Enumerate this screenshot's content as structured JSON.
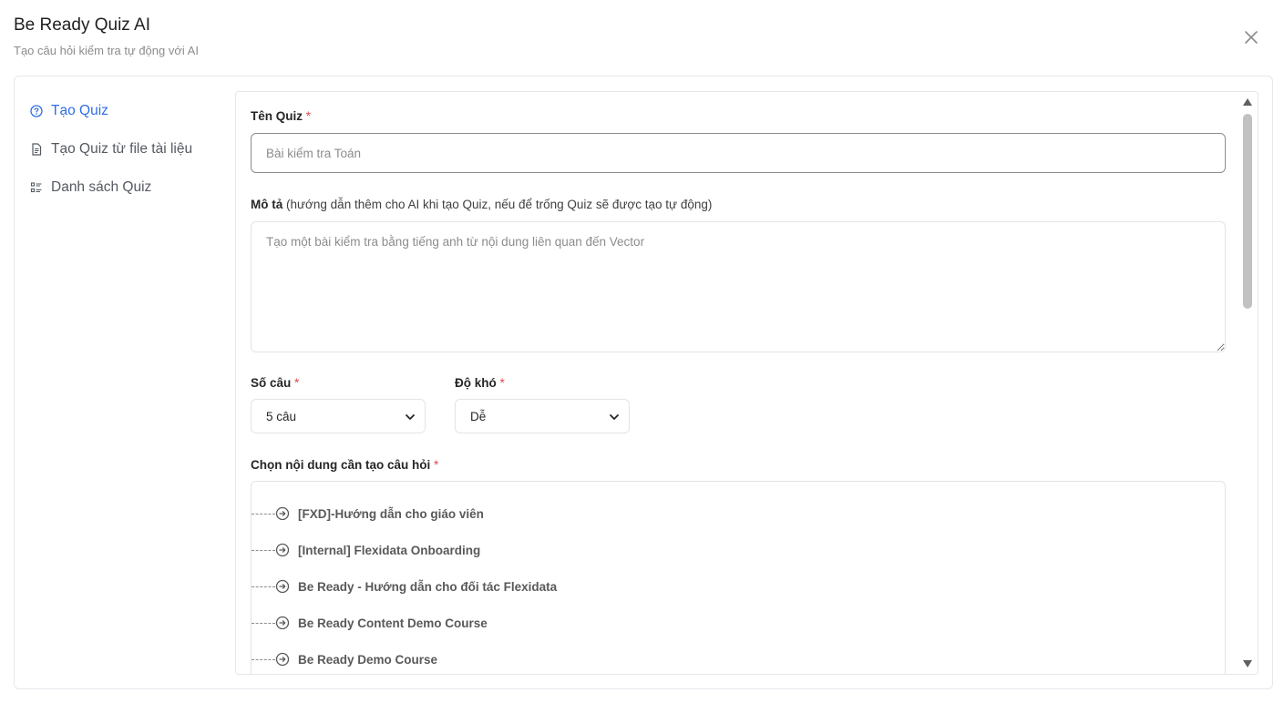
{
  "header": {
    "title": "Be Ready Quiz AI",
    "subtitle": "Tạo câu hỏi kiểm tra tự động với AI"
  },
  "sidebar": {
    "items": [
      {
        "label": "Tạo Quiz",
        "icon": "help-circle-icon",
        "active": true
      },
      {
        "label": "Tạo Quiz từ file tài liệu",
        "icon": "document-icon",
        "active": false
      },
      {
        "label": "Danh sách Quiz",
        "icon": "list-icon",
        "active": false
      }
    ]
  },
  "form": {
    "name_label": "Tên Quiz",
    "name_placeholder": "Bài kiểm tra Toán",
    "name_value": "",
    "desc_label": "Mô tả",
    "desc_hint": "(hướng dẫn thêm cho AI khi tạo Quiz, nếu để trống Quiz sẽ được tạo tự động)",
    "desc_placeholder": "Tạo một bài kiểm tra bằng tiếng anh từ nội dung liên quan đến Vector",
    "count_label": "Số câu",
    "count_value": "5 câu",
    "difficulty_label": "Độ khó",
    "difficulty_value": "Dễ",
    "content_label": "Chọn nội dung cần tạo câu hỏi",
    "required_mark": "*"
  },
  "content_tree": [
    "[FXD]-Hướng dẫn cho giáo viên",
    "[Internal] Flexidata Onboarding",
    "Be Ready - Hướng dẫn cho đối tác Flexidata",
    "Be Ready Content Demo Course",
    "Be Ready Demo Course"
  ],
  "colors": {
    "accent": "#2f6ee4",
    "required": "#e5484d",
    "muted": "#8c8c8c"
  }
}
